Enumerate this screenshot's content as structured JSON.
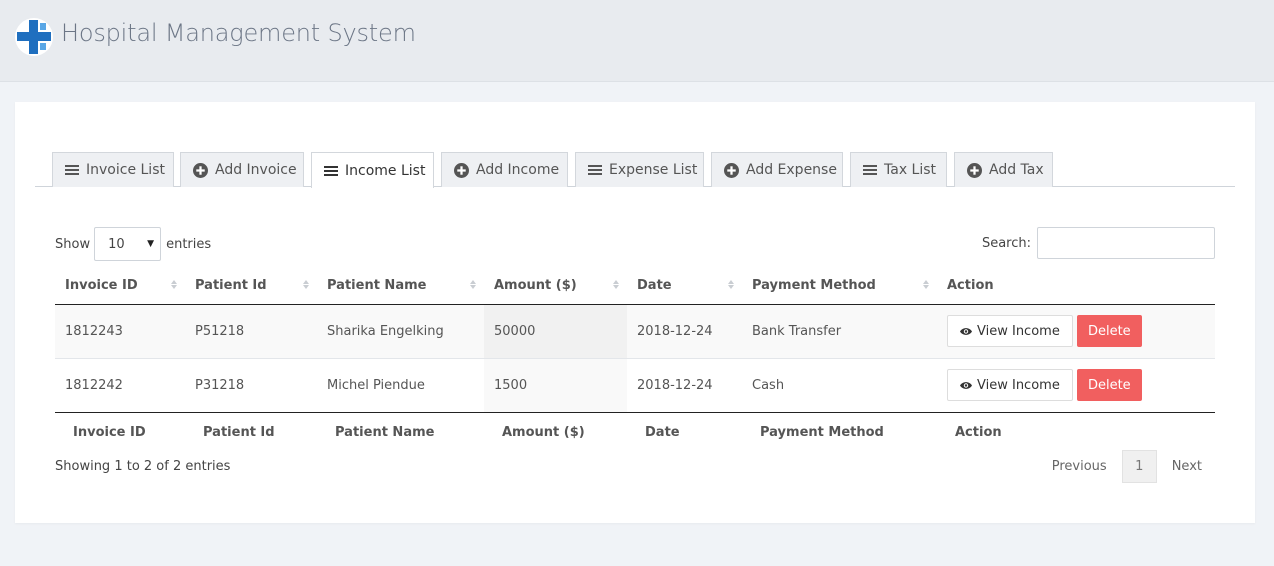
{
  "app": {
    "title": "Hospital Management System"
  },
  "tabs": [
    {
      "label": "Invoice List",
      "icon": "list-icon"
    },
    {
      "label": "Add Invoice",
      "icon": "plus-circle-icon"
    },
    {
      "label": "Income List",
      "icon": "list-icon",
      "active": true
    },
    {
      "label": "Add Income",
      "icon": "plus-circle-icon"
    },
    {
      "label": "Expense List",
      "icon": "list-icon"
    },
    {
      "label": "Add Expense",
      "icon": "plus-circle-icon"
    },
    {
      "label": "Tax List",
      "icon": "list-icon"
    },
    {
      "label": "Add Tax",
      "icon": "plus-circle-icon"
    }
  ],
  "table_controls": {
    "show_label": "Show",
    "entries_value": "10",
    "entries_label": "entries",
    "search_label": "Search:",
    "search_value": ""
  },
  "table": {
    "columns": [
      "Invoice ID",
      "Patient Id",
      "Patient Name",
      "Amount ($)",
      "Date",
      "Payment Method",
      "Action"
    ],
    "rows": [
      {
        "invoice_id": "1812243",
        "patient_id": "P51218",
        "patient_name": "Sharika Engelking",
        "amount": "50000",
        "date": "2018-12-24",
        "payment_method": "Bank Transfer"
      },
      {
        "invoice_id": "1812242",
        "patient_id": "P31218",
        "patient_name": "Michel Piendue",
        "amount": "1500",
        "date": "2018-12-24",
        "payment_method": "Cash"
      }
    ],
    "view_label": "View Income",
    "delete_label": "Delete"
  },
  "footer": {
    "info": "Showing 1 to 2 of 2 entries",
    "previous": "Previous",
    "current_page": "1",
    "next": "Next"
  },
  "colors": {
    "delete": "#f15f5f",
    "brand_blue": "#1f6fbf",
    "brand_light": "#5aa7e6"
  }
}
